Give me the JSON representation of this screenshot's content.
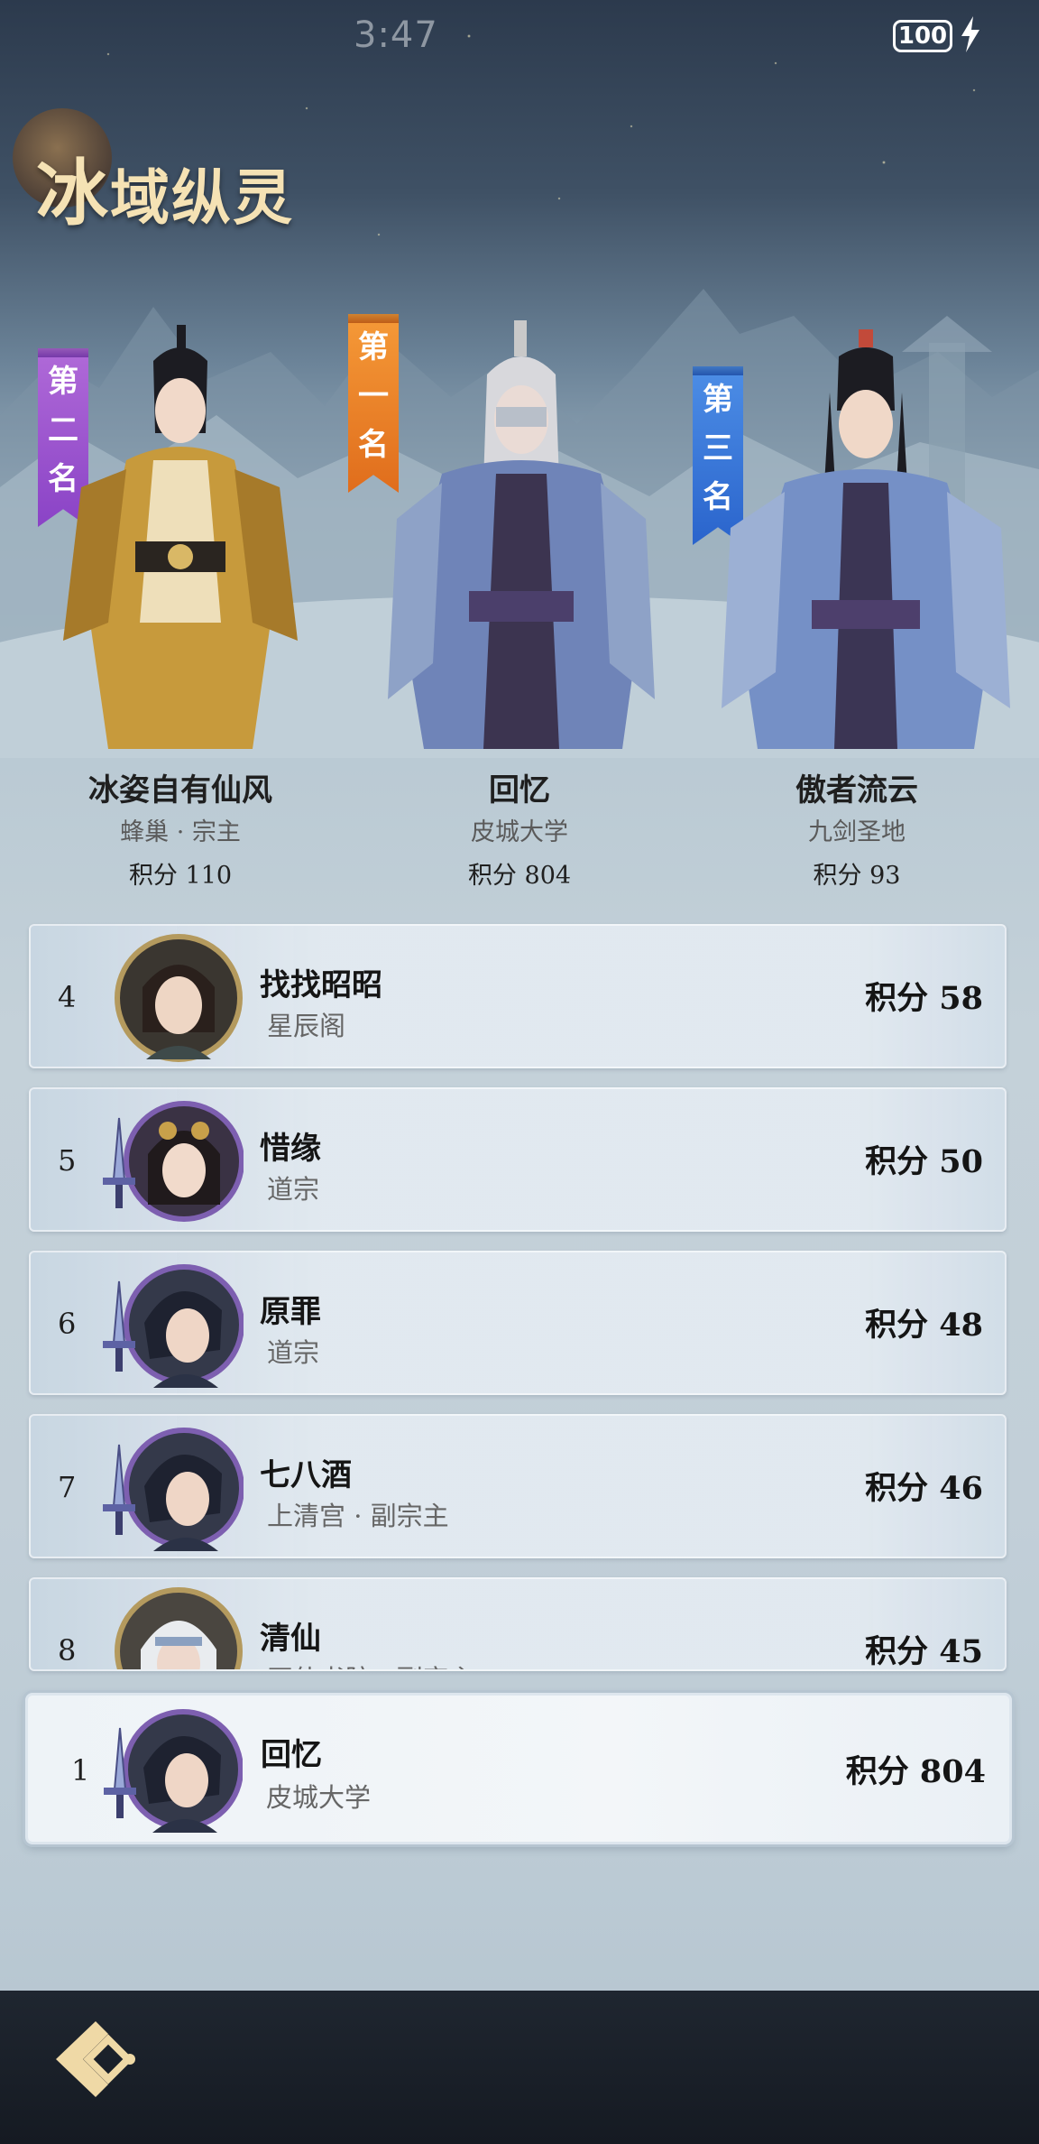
{
  "status": {
    "time": "3:47",
    "battery": "100"
  },
  "title": {
    "first": "冰",
    "rest": "域纵灵"
  },
  "podium": {
    "second": {
      "banner": [
        "第",
        "二",
        "名"
      ],
      "name": "冰姿自有仙风",
      "guild": "蜂巢 · 宗主",
      "score": "积分 110"
    },
    "first": {
      "banner": [
        "第",
        "一",
        "名"
      ],
      "name": "回忆",
      "guild": "皮城大学",
      "score": "积分 804"
    },
    "third": {
      "banner": [
        "第",
        "三",
        "名"
      ],
      "name": "傲者流云",
      "guild": "九剑圣地",
      "score": "积分 93"
    }
  },
  "ranking": [
    {
      "rank": "4",
      "name": "找找昭昭",
      "guild": "星辰阁",
      "score": "积分 58"
    },
    {
      "rank": "5",
      "name": "惜缘",
      "guild": "道宗",
      "score": "积分 50"
    },
    {
      "rank": "6",
      "name": "原罪",
      "guild": "道宗",
      "score": "积分 48"
    },
    {
      "rank": "7",
      "name": "七八酒",
      "guild": "上清宫 · 副宗主",
      "score": "积分 46"
    },
    {
      "rank": "8",
      "name": "清仙",
      "guild": "开仙书院 · 副宗主",
      "score": "积分 45"
    }
  ],
  "me": {
    "rank": "1",
    "name": "回忆",
    "guild": "皮城大学",
    "score": "积分 804"
  },
  "colors": {
    "accent_gold": "#f5e2b4",
    "banner_first": "#e06d1c",
    "banner_second": "#8a43c6",
    "banner_third": "#2a64cc"
  },
  "icons": [
    "battery-icon",
    "charging-bolt-icon",
    "sword-badge-icon",
    "back-arrow-icon"
  ]
}
